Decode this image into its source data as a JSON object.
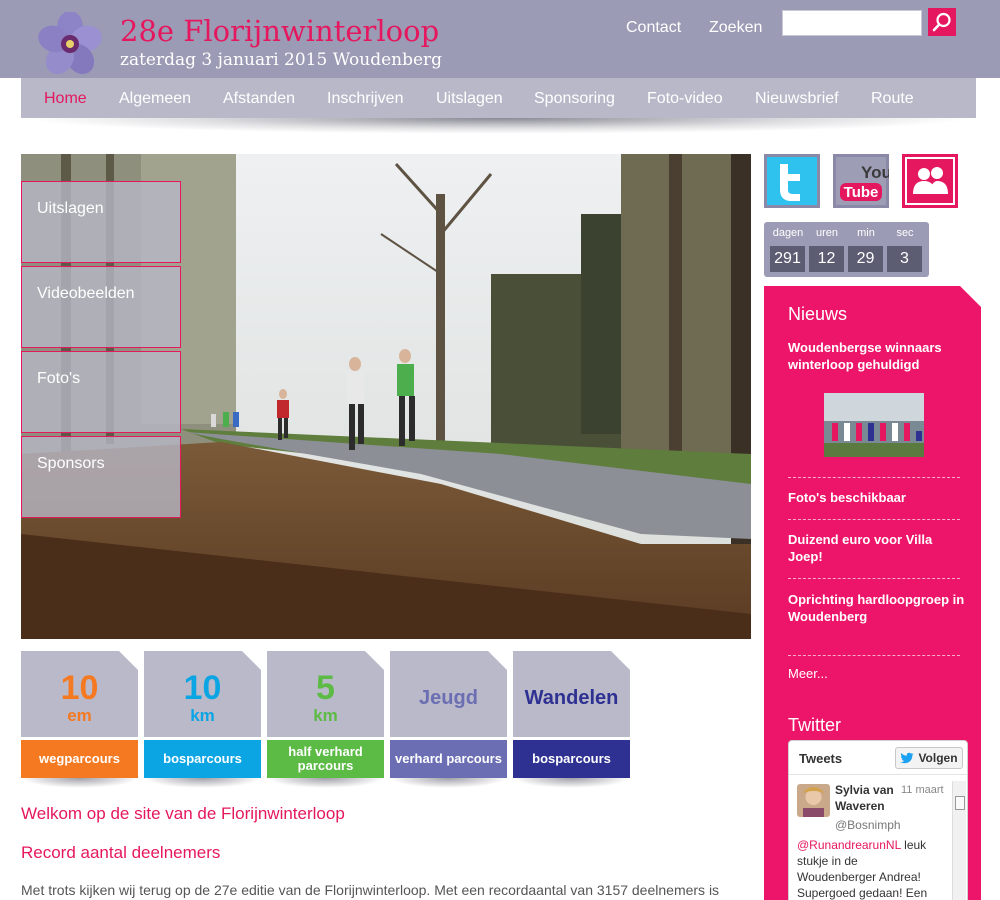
{
  "header": {
    "title": "28e Florijnwinterloop",
    "subtitle": "zaterdag 3 januari 2015 Woudenberg",
    "links": [
      "Contact",
      "Zoeken"
    ],
    "search_placeholder": ""
  },
  "nav": {
    "items": [
      "Home",
      "Algemeen",
      "Afstanden",
      "Inschrijven",
      "Uitslagen",
      "Sponsoring",
      "Foto-video",
      "Nieuwsbrief",
      "Route"
    ],
    "active": "Home"
  },
  "side_tiles": [
    "Uitslagen",
    "Videobeelden",
    "Foto's",
    "Sponsors"
  ],
  "cards": [
    {
      "big": "10",
      "small": "em",
      "label": "wegparcours",
      "color": "#f47920"
    },
    {
      "big": "10",
      "small": "km",
      "label": "bosparcours",
      "color": "#0ba5e4"
    },
    {
      "big": "5",
      "small": "km",
      "label": "half verhard parcours",
      "color": "#5cbb45"
    },
    {
      "big": "Jeugd",
      "small": "",
      "label": "verhard  parcours",
      "color": "#6b6eb3"
    },
    {
      "big": "Wandelen",
      "small": "",
      "label": "bosparcours",
      "color": "#2e3192"
    }
  ],
  "content": {
    "welcome": "Welkom op de site van de Florijnwinterloop",
    "headline": "Record aantal deelnemers",
    "body": "Met trots kijken wij terug op de 27e editie van de Florijnwinterloop. Met een recordaantal van 3157 deelnemers is"
  },
  "social": {
    "twitter": "twitter-icon",
    "youtube_top": "You",
    "youtube_bottom": "Tube",
    "community": "community-icon"
  },
  "countdown": {
    "units": [
      "dagen",
      "uren",
      "min",
      "sec"
    ],
    "values": [
      "291",
      "12",
      "29",
      "3"
    ]
  },
  "news": {
    "heading": "Nieuws",
    "items": [
      "Woudenbergse winnaars winterloop gehuldigd",
      "Foto's beschikbaar",
      "Duizend euro voor Villa Joep!",
      "Oprichting hardloopgroep in Woudenberg"
    ],
    "more": "Meer..."
  },
  "twitter": {
    "heading": "Twitter",
    "widget_title": "Tweets",
    "follow_label": "Volgen",
    "tweet": {
      "name": "Sylvia van Waveren",
      "handle": "@Bosnimph",
      "date": "11 maart",
      "mention": "@RunandrearunNL",
      "text": " leuk stukje in de Woudenberger Andrea! Supergoed gedaan! Een"
    }
  },
  "colors": {
    "brand_pink": "#e5175e",
    "header_bg": "#9b9bb5",
    "nav_bg": "#b8b8c9"
  }
}
